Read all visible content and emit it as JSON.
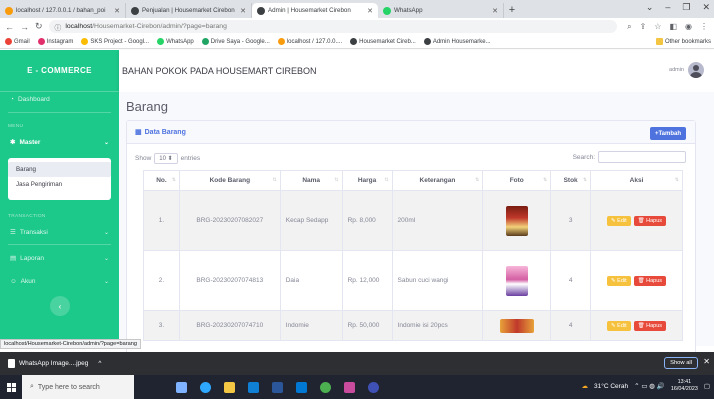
{
  "browser": {
    "tabs": [
      {
        "label": "localhost / 127.0.0.1 / bahan_poi",
        "icon": "phpmyadmin-icon",
        "color": "#f89c0e"
      },
      {
        "label": "Penjualan | Housemarket Cirebon",
        "icon": "globe-icon",
        "color": "#3c4043"
      },
      {
        "label": "Admin | Housemarket Cirebon",
        "icon": "globe-icon",
        "color": "#3c4043"
      },
      {
        "label": "WhatsApp",
        "icon": "whatsapp-icon",
        "color": "#25d366"
      }
    ],
    "new_tab": "+",
    "url_host": "localhost",
    "url_path": "/Housemarket-Cirebon/admin/?page=barang",
    "bookmarks": [
      {
        "label": "Gmail",
        "color": "#ea4335"
      },
      {
        "label": "Instagram",
        "color": "#e1306c"
      },
      {
        "label": "SKS Project - Googl...",
        "color": "#fbbc04"
      },
      {
        "label": "WhatsApp",
        "color": "#25d366"
      },
      {
        "label": "Drive Saya - Google...",
        "color": "#1fa463"
      },
      {
        "label": "localhost / 127.0.0....",
        "color": "#f89c0e"
      },
      {
        "label": "Housemarket Cireb...",
        "color": "#3c4043"
      },
      {
        "label": "Admin Housemarke...",
        "color": "#3c4043"
      }
    ],
    "other_bookmarks": "Other bookmarks",
    "status_url": "localhost/Housemarket-Cirebon/admin/?page=barang"
  },
  "sidebar": {
    "brand": "E - COMMERCE",
    "dashboard": "Dashboard",
    "heading_menu": "MENU",
    "master": "Master",
    "submenu": [
      "Barang",
      "Jasa Pengiriman"
    ],
    "heading_transaction": "TRANSACTION",
    "transaksi": "Transaksi",
    "laporan": "Laporan",
    "akun": "Akun",
    "accent": "#1cc88a"
  },
  "topbar": {
    "title": "BAHAN POKOK PADA HOUSEMART CIREBON",
    "user": "admin"
  },
  "main": {
    "page_title": "Barang",
    "card_title": "Data Barang",
    "add_button": "+Tambah",
    "show_label": "Show",
    "show_value": "10",
    "entries_label": "entries",
    "search_label": "Search:",
    "columns": [
      "No.",
      "Kode Barang",
      "Nama",
      "Harga",
      "Keterangan",
      "Foto",
      "Stok",
      "Aksi"
    ],
    "rows": [
      {
        "no": "1.",
        "kode": "BRG-20230207082027",
        "nama": "Kecap Sedapp",
        "harga": "Rp. 8,000",
        "ket": "200ml",
        "stok": "3",
        "photo_color": "#c0392b"
      },
      {
        "no": "2.",
        "kode": "BRG-20230207074813",
        "nama": "Daia",
        "harga": "Rp. 12,000",
        "ket": "Sabun cuci wangi",
        "stok": "4",
        "photo_color": "#d35fa3"
      },
      {
        "no": "3.",
        "kode": "BRG-20230207074710",
        "nama": "Indomie",
        "harga": "Rp. 50,000",
        "ket": "Indomie isi 20pcs",
        "stok": "4",
        "photo_color": "#e8a23a"
      }
    ],
    "edit_label": "Edit",
    "delete_label": "Hapus",
    "primary": "#4e73df",
    "warning": "#f6c23e",
    "danger": "#e74a3b"
  },
  "download": {
    "file": "WhatsApp Image....jpeg",
    "show_all": "Show all"
  },
  "taskbar": {
    "search_placeholder": "Type here to search",
    "weather": "31°C  Cerah",
    "time": "13:41",
    "date": "16/04/2023"
  }
}
